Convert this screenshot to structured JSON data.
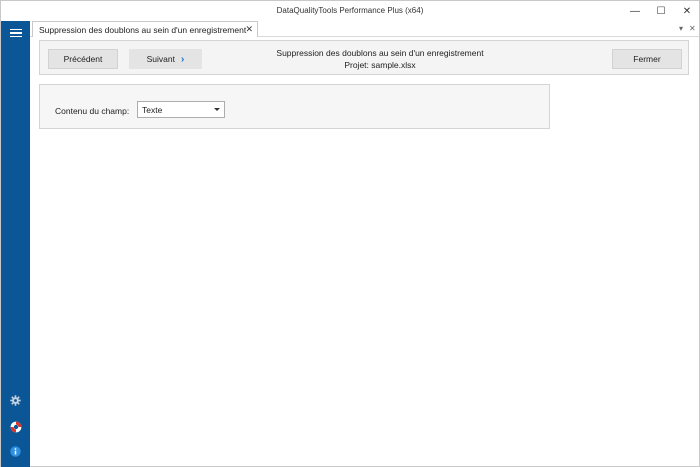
{
  "window": {
    "title": "DataQualityTools Performance Plus (x64)",
    "minimize": "—",
    "maximize": "☐",
    "close": "✕"
  },
  "tabs": [
    {
      "label": "Suppression des doublons au sein d'un enregistrement",
      "close": "✕"
    }
  ],
  "tabstrip": {
    "dropdown": "▾",
    "close": "✕"
  },
  "toolbar": {
    "prev_label": "Précédent",
    "next_label": "Suivant",
    "next_chevron": "›",
    "title_line1": "Suppression des doublons au sein d'un enregistrement",
    "title_line2": "Projet: sample.xlsx",
    "close_label": "Fermer"
  },
  "form": {
    "field_label": "Contenu du champ:",
    "select_value": "Texte"
  },
  "sidebar": {
    "icons": [
      "menu-icon",
      "gear-icon",
      "lifebuoy-icon",
      "info-icon"
    ]
  },
  "colors": {
    "sidebar": "#0a5697",
    "accent": "#1a73c8"
  }
}
